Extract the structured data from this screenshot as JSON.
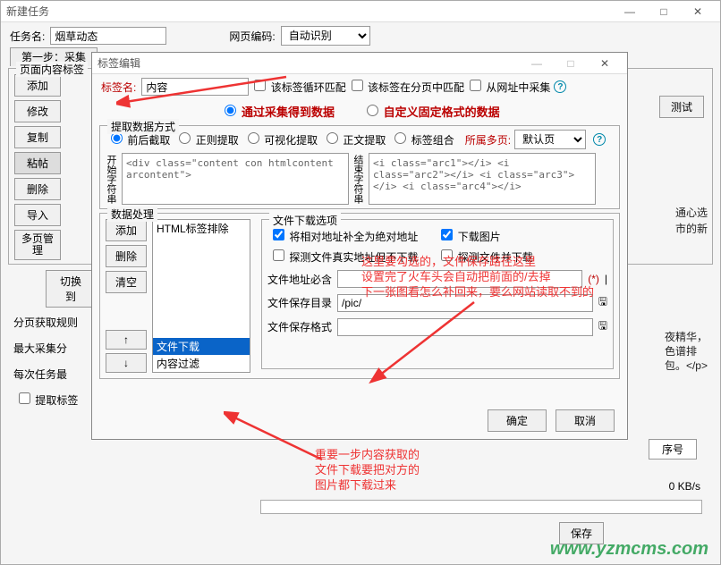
{
  "main": {
    "title": "新建任务",
    "taskname_label": "任务名:",
    "taskname_value": "烟草动态",
    "encoding_label": "网页编码:",
    "encoding_value": "自动识别",
    "step1_label": "第一步：采集",
    "page_tag_group": "页面内容标签",
    "buttons": {
      "add": "添加",
      "edit": "修改",
      "copy": "复制",
      "paste": "粘帖",
      "delete": "删除",
      "import": "导入",
      "multi": "多页管理"
    },
    "switch": "切换到",
    "paging_rule": "分页获取规则",
    "max_collect": "最大采集分",
    "per_task": "每次任务最",
    "extract_tag": "提取标签",
    "test_btn": "测试",
    "right_text1": "通心选",
    "right_text2": "市的新",
    "right_text3": "夜精华，",
    "right_text4": "色谱排",
    "right_text5": "包。</p>",
    "right_text6": "(*) |",
    "seq": "序号",
    "speed": "0 KB/s",
    "save": "保存"
  },
  "dialog": {
    "title": "标签编辑",
    "tagname_label": "标签名:",
    "tagname_value": "内容",
    "chk_loop": "该标签循环匹配",
    "chk_paging": "该标签在分页中匹配",
    "chk_url": "从网址中采集",
    "radio_collect": "通过采集得到数据",
    "radio_custom": "自定义固定格式的数据",
    "extract_group": "提取数据方式",
    "r_ba": "前后截取",
    "r_regex": "正则提取",
    "r_visual": "可视化提取",
    "r_content": "正文提取",
    "r_combo": "标签组合",
    "multi_label": "所属多页:",
    "multi_value": "默认页",
    "start_label": "开始字符串",
    "end_label": "结束字符串",
    "start_val": "<div class=\"content con htmlcontent arcontent\">",
    "end_val": "<i class=\"arc1\"></i> <i class=\"arc2\"></i> <i class=\"arc3\"></i> <i class=\"arc4\"></i>",
    "proc_group": "数据处理",
    "proc_add": "添加",
    "proc_del": "删除",
    "proc_clear": "清空",
    "list": {
      "i1": "HTML标签排除",
      "i2": "文件下载",
      "i3": "内容过滤"
    },
    "file_group": "文件下载选项",
    "chk_abs": "将相对地址补全为绝对地址",
    "chk_dl": "下载图片",
    "chk_probe": "探测文件真实地址但不下载",
    "chk_probedl": "探测文件并下载",
    "addr_label": "文件地址必含",
    "save_label": "文件保存目录",
    "save_val": "/pic/",
    "fmt_label": "文件保存格式",
    "ok": "确定",
    "cancel": "取消",
    "star": "(*)"
  },
  "anno": {
    "a1_l1": "这里要勾选的，文件保存路径这里",
    "a1_l2": "设置完了火车头会自动把前面的/去掉",
    "a1_l3": "下一张图看怎么补回来，要么网站读取不到的",
    "a2_l1": "重要一步内容获取的",
    "a2_l2": "文件下载要把对方的",
    "a2_l3": "图片都下载过来"
  },
  "brand": "www.yzmcms.com"
}
